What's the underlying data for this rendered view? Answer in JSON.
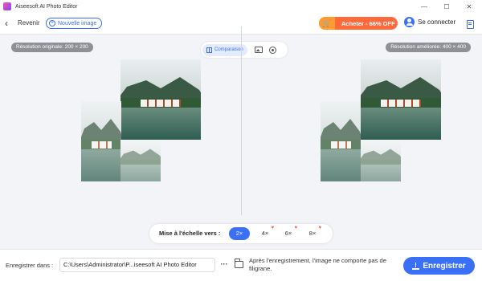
{
  "window": {
    "title": "Aiseesoft AI Photo Editor",
    "minimize": "—",
    "maximize": "☐",
    "close": "✕"
  },
  "toolbar": {
    "back_label": "Revenir",
    "back_icon": "←",
    "new_image_label": "Nouvelle image",
    "buy_label": "Acheter - 66% OFF",
    "login_label": "Se connecter"
  },
  "workspace": {
    "original_resolution": "Résolution originale: 200 × 200",
    "enhanced_resolution": "Résolution améliorée: 400 × 400",
    "compare_label": "Comparaison"
  },
  "scale": {
    "label": "Mise à l'échelle vers :",
    "options": [
      "2×",
      "4×",
      "6×",
      "8×"
    ],
    "selected": "2×"
  },
  "bottom": {
    "save_label": "Enregistrer dans :",
    "path": "C:\\Users\\Administrator\\P...iseesoft AI Photo Editor",
    "more_label": "···",
    "note": "Après l'enregistrement, l'image ne comporte pas de filigrane.",
    "export_label": "Enregistrer"
  },
  "colors": {
    "accent": "#3a6ff7",
    "buy": "#ff6a3d",
    "badge": "#8e9096"
  }
}
